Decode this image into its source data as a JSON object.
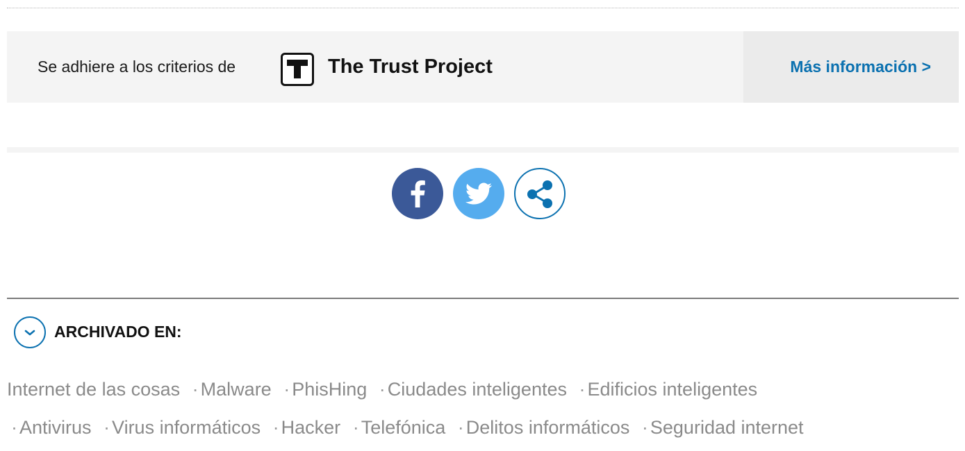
{
  "trust": {
    "intro": "Se adhiere a los criterios de",
    "logo_letter": "T",
    "name": "The Trust Project",
    "more_info": "Más información >"
  },
  "share": {
    "buttons": [
      {
        "network": "facebook",
        "icon": "facebook-icon",
        "color": "#3b5998"
      },
      {
        "network": "twitter",
        "icon": "twitter-icon",
        "color": "#55acee"
      },
      {
        "network": "share",
        "icon": "share-icon",
        "color": "#0b71b0"
      }
    ]
  },
  "archive": {
    "title": "ARCHIVADO EN:",
    "toggle_icon": "chevron-down-icon",
    "tags": [
      "Internet de las cosas",
      "Malware",
      "PhisHing",
      "Ciudades inteligentes",
      "Edificios inteligentes",
      "Antivirus",
      "Virus informáticos",
      "Hacker",
      "Telefónica",
      "Delitos informáticos",
      "Seguridad internet"
    ]
  },
  "colors": {
    "accent": "#0b71b0",
    "tag_text": "#8a8a8a",
    "panel_bg": "#f4f4f4"
  }
}
